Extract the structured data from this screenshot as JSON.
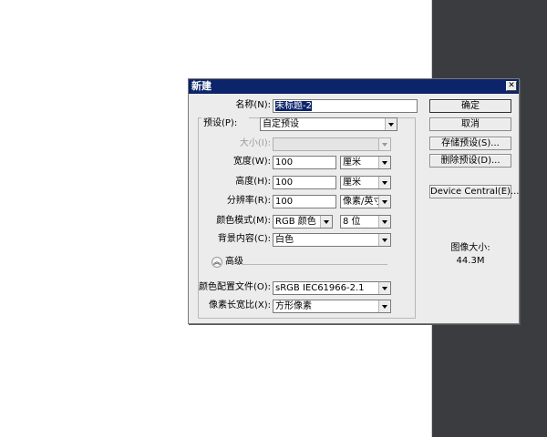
{
  "dialog": {
    "title": "新建",
    "name_label": "名称(N):",
    "name_value": "未标题-2",
    "preset_label": "预设(P):",
    "preset_value": "自定预设",
    "size_label": "大小(I):",
    "size_value": "",
    "width_label": "宽度(W):",
    "width_value": "100",
    "width_unit": "厘米",
    "height_label": "高度(H):",
    "height_value": "100",
    "height_unit": "厘米",
    "resolution_label": "分辨率(R):",
    "resolution_value": "100",
    "resolution_unit": "像素/英寸",
    "color_mode_label": "颜色模式(M):",
    "color_mode_value": "RGB 颜色",
    "bit_depth_value": "8 位",
    "background_label": "背景内容(C):",
    "background_value": "白色",
    "advanced_label": "高级",
    "profile_label": "颜色配置文件(O):",
    "profile_value": "sRGB IEC61966-2.1",
    "pixel_aspect_label": "像素长宽比(X):",
    "pixel_aspect_value": "方形像素"
  },
  "buttons": {
    "ok": "确定",
    "cancel": "取消",
    "save_preset": "存储预设(S)...",
    "delete_preset": "删除预设(D)...",
    "device_central": "Device Central(E)..."
  },
  "info": {
    "image_size_label": "图像大小:",
    "image_size_value": "44.3M"
  },
  "colors": {
    "titlebar": "#0b246a",
    "dialog_bg": "#ececec",
    "workspace": "#3a3c40",
    "selection": "#0a246a"
  }
}
